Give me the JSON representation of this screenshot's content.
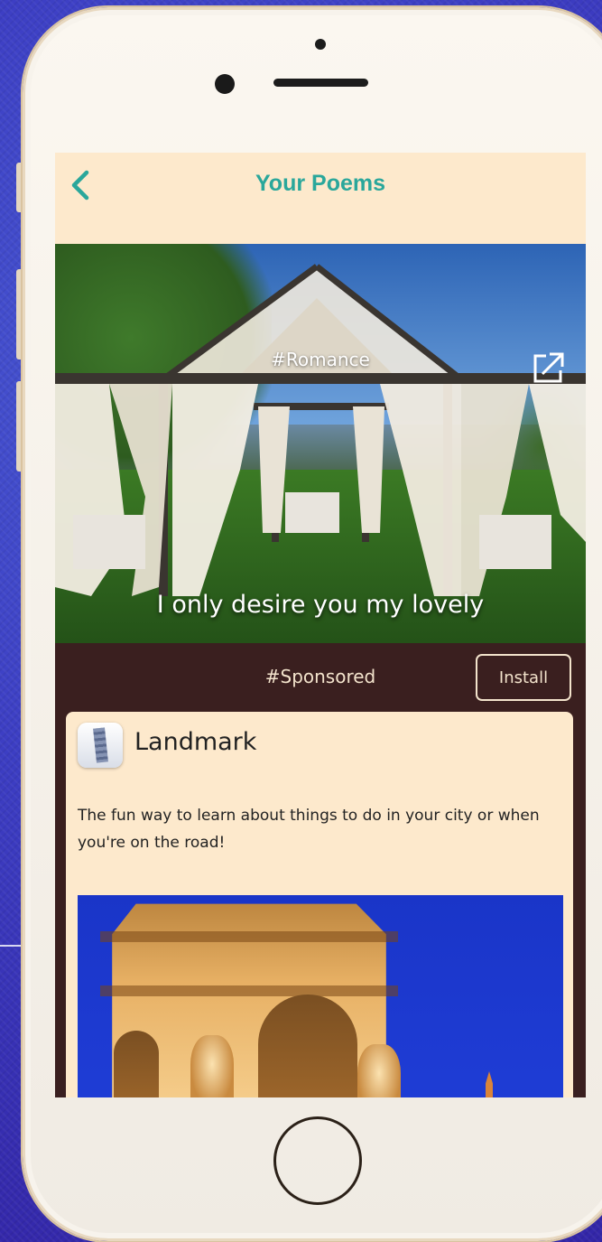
{
  "nav": {
    "title": "Your Poems",
    "back_icon": "chevron-left-icon"
  },
  "poem": {
    "tag": "#Romance",
    "text": "I only desire you my lovely",
    "share_icon": "external-link-icon"
  },
  "sponsored": {
    "tag": "#Sponsored",
    "install_label": "Install",
    "ad": {
      "app_name": "Landmark",
      "description": "The fun way to learn about things to do in your city or when you're on the road!"
    }
  },
  "colors": {
    "nav_background": "#fde9cc",
    "accent": "#2aa79b",
    "sponsored_background": "#3a1f1f"
  }
}
